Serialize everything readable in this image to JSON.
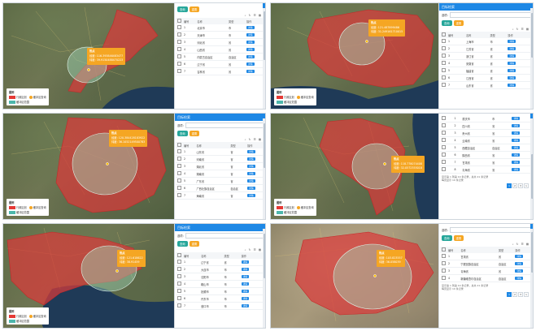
{
  "legend": {
    "title": "图例",
    "items": [
      {
        "label": "行政区划",
        "color": "#e53935"
      },
      {
        "label": "缓冲区查询",
        "color": "#f5a623"
      },
      {
        "label": "缓冲区范围",
        "color": "#4db6ac"
      }
    ]
  },
  "sidebar": {
    "title": "目标检索",
    "search_label": "选项:",
    "query_button": "查询",
    "reset_button": "重置",
    "columns": [
      "编号",
      "名称",
      "类型",
      "操作"
    ],
    "action_label": "详情",
    "pagination_text": "显示第 1 到第 10 条记录，总共 21 条记录",
    "page_size_text": "每页显示 10 条记录",
    "pages": [
      "1",
      "2",
      "3",
      ">"
    ]
  },
  "panels": [
    {
      "tooltip": {
        "title": "热点",
        "lines": [
          "经度: 116.393846483477",
          "纬度: 39.9150488470223"
        ]
      },
      "rows": [
        [
          "1",
          "北京市",
          "市",
          "1"
        ],
        [
          "2",
          "天津市",
          "市",
          "1"
        ],
        [
          "3",
          "河北省",
          "省",
          "1"
        ],
        [
          "4",
          "山西省",
          "省",
          "1"
        ],
        [
          "5",
          "内蒙古自治区",
          "自治区",
          "1"
        ],
        [
          "6",
          "辽宁省",
          "省",
          "1"
        ],
        [
          "7",
          "吉林省",
          "省",
          "1"
        ]
      ]
    },
    {
      "tooltip": {
        "title": "热点",
        "lines": [
          "经度: 121.487899486",
          "纬度: 31.249161710015"
        ]
      },
      "rows": [
        [
          "1",
          "上海市",
          "市",
          "1"
        ],
        [
          "2",
          "江苏省",
          "省",
          "1"
        ],
        [
          "3",
          "浙江省",
          "省",
          "1"
        ],
        [
          "4",
          "安徽省",
          "省",
          "1"
        ],
        [
          "5",
          "福建省",
          "省",
          "1"
        ],
        [
          "6",
          "江西省",
          "省",
          "1"
        ],
        [
          "7",
          "山东省",
          "省",
          "1"
        ]
      ]
    },
    {
      "tooltip": {
        "title": "热点",
        "lines": [
          "经度: 120.384428183922",
          "纬度: 36.1052149500783"
        ]
      },
      "rows": [
        [
          "1",
          "山东省",
          "省",
          "1"
        ],
        [
          "2",
          "河南省",
          "省",
          "1"
        ],
        [
          "3",
          "湖北省",
          "省",
          "1"
        ],
        [
          "4",
          "湖南省",
          "省",
          "1"
        ],
        [
          "5",
          "广东省",
          "省",
          "1"
        ],
        [
          "6",
          "广西壮族自治区",
          "自治区",
          "1"
        ],
        [
          "7",
          "海南省",
          "省",
          "1"
        ]
      ]
    },
    {
      "tooltip": {
        "title": "热点",
        "lines": [
          "经度: 118.778074408",
          "纬度: 32.0572355018"
        ]
      },
      "rows": [
        [
          "1",
          "重庆市",
          "市",
          "1"
        ],
        [
          "2",
          "四川省",
          "省",
          "1"
        ],
        [
          "3",
          "贵州省",
          "省",
          "1"
        ],
        [
          "4",
          "云南省",
          "省",
          "1"
        ],
        [
          "5",
          "西藏自治区",
          "自治区",
          "1"
        ],
        [
          "6",
          "陕西省",
          "省",
          "1"
        ],
        [
          "7",
          "甘肃省",
          "省",
          "1"
        ],
        [
          "8",
          "青海省",
          "省",
          "1"
        ]
      ]
    },
    {
      "tooltip": {
        "title": "热点",
        "lines": [
          "经度: 121.618622",
          "纬度: 38.91459"
        ]
      },
      "rows": [
        [
          "1",
          "辽宁省",
          "省",
          "1"
        ],
        [
          "2",
          "大连市",
          "市",
          "1"
        ],
        [
          "3",
          "沈阳市",
          "市",
          "1"
        ],
        [
          "4",
          "鞍山市",
          "市",
          "1"
        ],
        [
          "5",
          "抚顺市",
          "市",
          "1"
        ],
        [
          "6",
          "丹东市",
          "市",
          "1"
        ],
        [
          "7",
          "营口市",
          "市",
          "1"
        ]
      ]
    },
    {
      "tooltip": {
        "title": "热点",
        "lines": [
          "经度: 103.823557",
          "纬度: 36.058039"
        ]
      },
      "rows": [
        [
          "1",
          "甘肃省",
          "省",
          "1"
        ],
        [
          "2",
          "宁夏回族自治区",
          "自治区",
          "1"
        ],
        [
          "3",
          "青海省",
          "省",
          "1"
        ],
        [
          "4",
          "新疆维吾尔自治区",
          "自治区",
          "1"
        ]
      ]
    }
  ]
}
